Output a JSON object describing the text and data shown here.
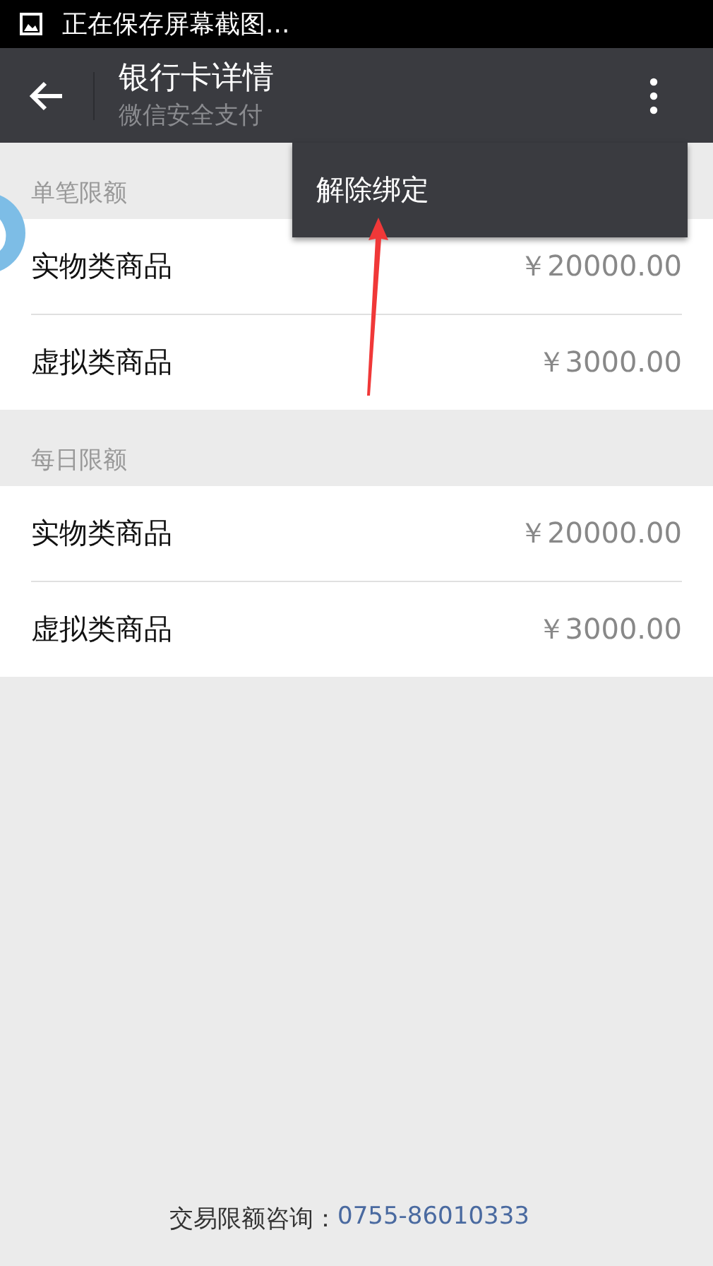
{
  "status_bar": {
    "text": "正在保存屏幕截图..."
  },
  "header": {
    "title": "银行卡详情",
    "subtitle": "微信安全支付"
  },
  "menu": {
    "items": [
      "解除绑定"
    ]
  },
  "sections": [
    {
      "title": "单笔限额",
      "rows": [
        {
          "label": "实物类商品",
          "amount": "￥20000.00"
        },
        {
          "label": "虚拟类商品",
          "amount": "￥3000.00"
        }
      ]
    },
    {
      "title": "每日限额",
      "rows": [
        {
          "label": "实物类商品",
          "amount": "￥20000.00"
        },
        {
          "label": "虚拟类商品",
          "amount": "￥3000.00"
        }
      ]
    }
  ],
  "footer": {
    "label": "交易限额咨询：",
    "phone": "0755-86010333"
  }
}
